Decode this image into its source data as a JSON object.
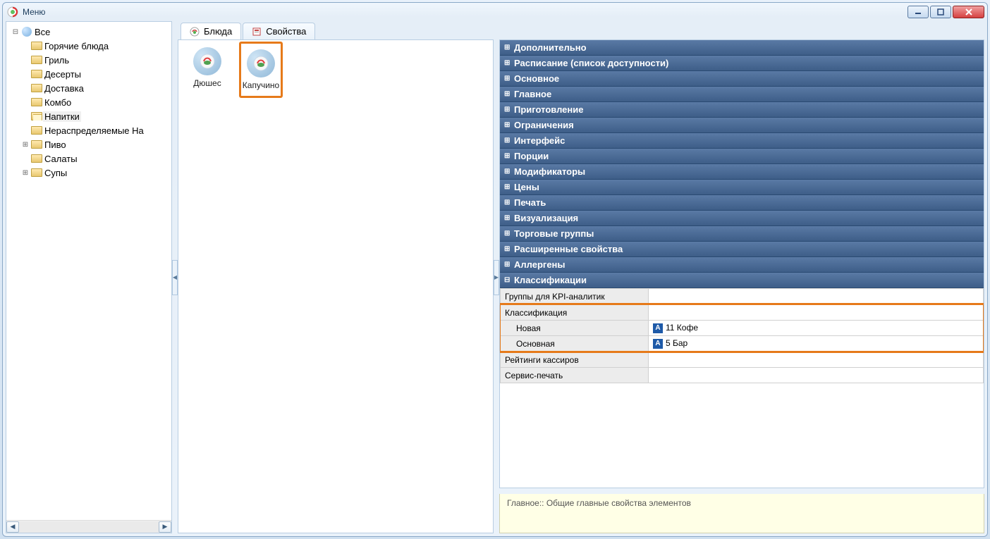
{
  "window": {
    "title": "Меню"
  },
  "tree": {
    "root": "Все",
    "items": [
      "Горячие блюда",
      "Гриль",
      "Десерты",
      "Доставка",
      "Комбо",
      "Напитки",
      "Нераспределяемые На",
      "Пиво",
      "Салаты",
      "Супы"
    ],
    "selected": "Напитки"
  },
  "tabs": {
    "dishes": "Блюда",
    "props": "Свойства"
  },
  "dishes": [
    {
      "name": "Дюшес"
    },
    {
      "name": "Капучино",
      "selected": true
    }
  ],
  "prop_groups": [
    "Дополнительно",
    "Расписание (список доступности)",
    "Основное",
    "Главное",
    "Приготовление",
    "Ограничения",
    "Интерфейс",
    "Порции",
    "Модификаторы",
    "Цены",
    "Печать",
    "Визуализация",
    "Торговые группы",
    "Расширенные свойства",
    "Аллергены"
  ],
  "classif_group": "Классификации",
  "classif_rows": {
    "kpi": {
      "name": "Группы для KPI-аналитик",
      "value": ""
    },
    "klass": {
      "name": "Классификация",
      "value": ""
    },
    "novaya": {
      "name": "Новая",
      "value": "11 Кофе"
    },
    "osnov": {
      "name": "Основная",
      "value": "5 Бар"
    },
    "rating": {
      "name": "Рейтинги кассиров",
      "value": ""
    },
    "service": {
      "name": "Сервис-печать",
      "value": ""
    }
  },
  "hint": "Главное:: Общие главные свойства элементов"
}
